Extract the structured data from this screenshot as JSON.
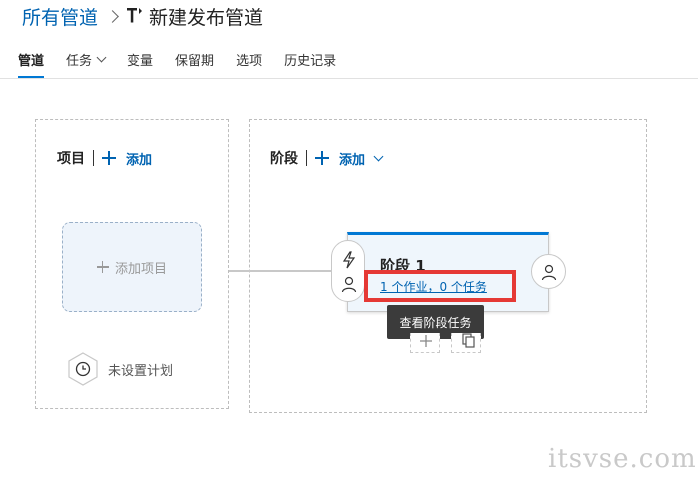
{
  "breadcrumb": {
    "root": "所有管道",
    "current": "新建发布管道"
  },
  "tabs": [
    {
      "label": "管道",
      "active": true
    },
    {
      "label": "任务",
      "has_dropdown": true
    },
    {
      "label": "变量"
    },
    {
      "label": "保留期"
    },
    {
      "label": "选项"
    },
    {
      "label": "历史记录"
    }
  ],
  "artifacts": {
    "title": "项目",
    "add_label": "添加",
    "add_artifact_label": "添加项目",
    "schedule_label": "未设置计划"
  },
  "stages": {
    "title": "阶段",
    "add_label": "添加",
    "stage": {
      "name": "阶段 1",
      "tasks_link": "1 个作业，0 个任务"
    },
    "tooltip": "查看阶段任务"
  },
  "watermark": "itsvse.com",
  "colors": {
    "accent": "#0078d4",
    "link": "#0063b1",
    "highlight": "#e53935",
    "stage_bg": "#eff6fc"
  },
  "icons": {
    "pipeline": "pipeline-icon",
    "trigger": "lightning-icon",
    "approver": "person-icon",
    "schedule": "clock-icon"
  }
}
